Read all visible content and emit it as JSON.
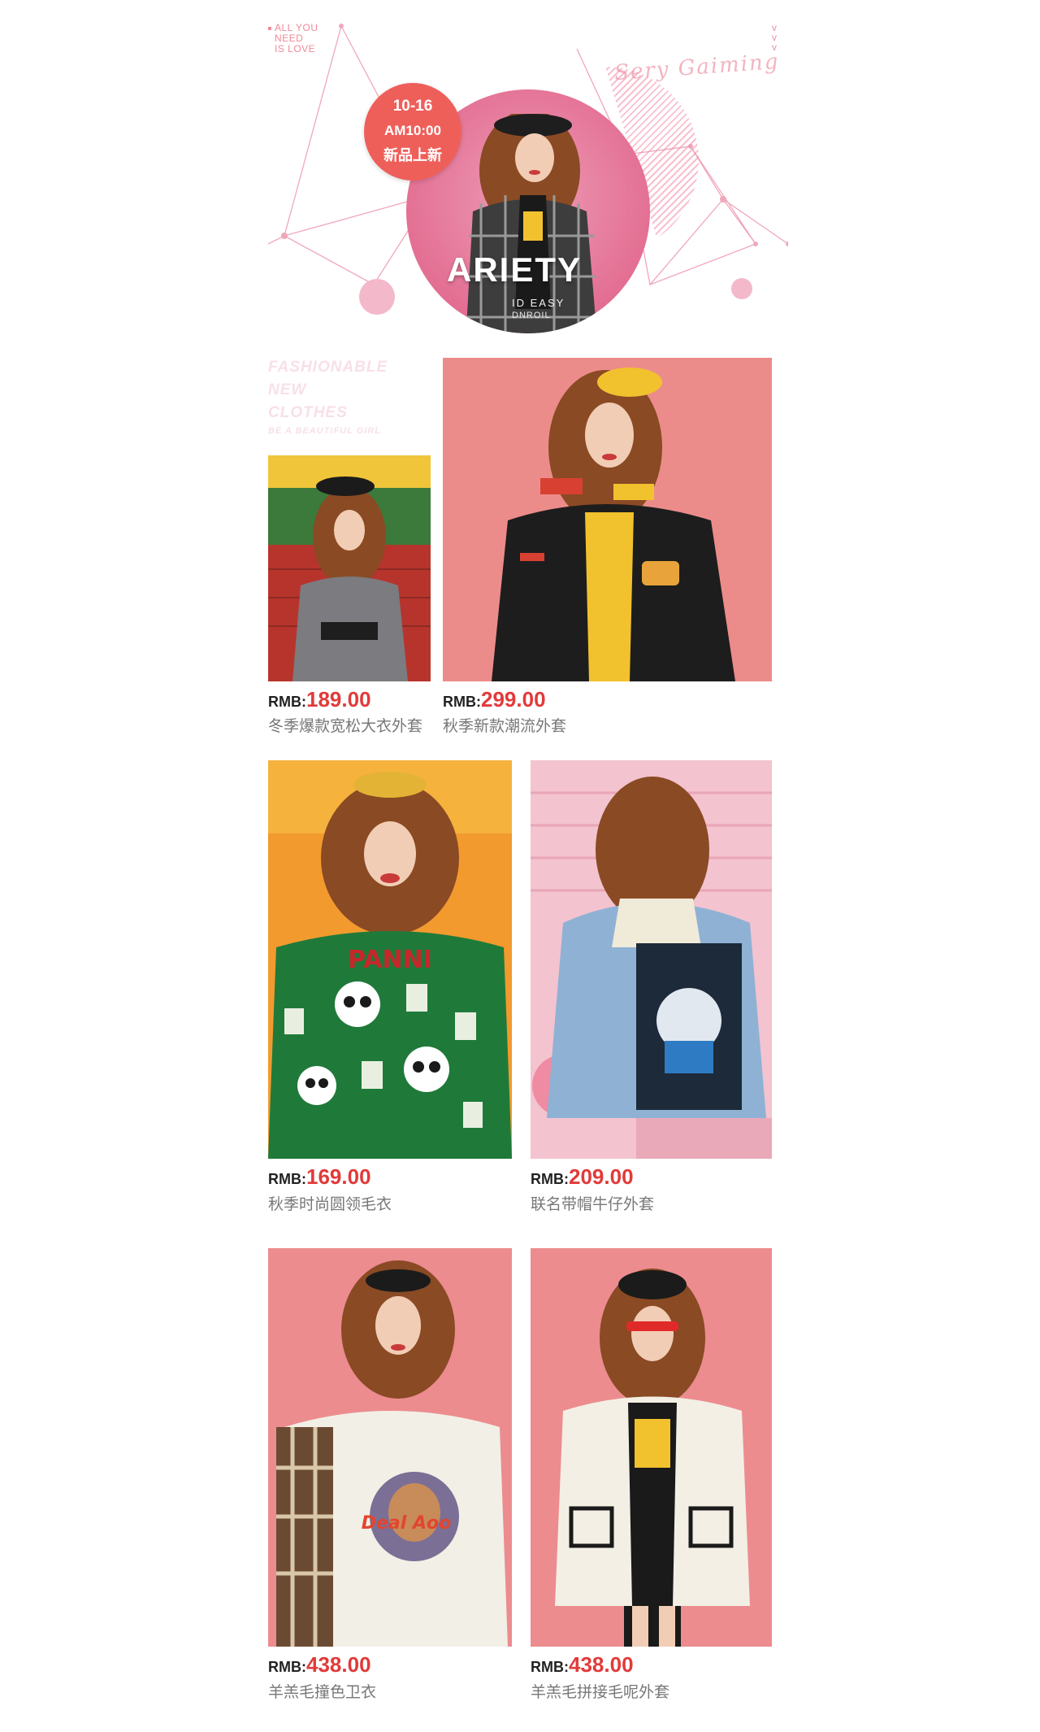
{
  "hero": {
    "tagline": [
      "ALL YOU",
      "NEED",
      "IS LOVE"
    ],
    "script_text": "Sery Gaiming",
    "v_marks": [
      "v",
      "v",
      "v"
    ],
    "badge": {
      "date": "10-16",
      "time": "AM10:00",
      "label": "新品上新"
    },
    "brand": "ARIETY",
    "brand_sub": "ID EASY",
    "brand_sub2": "DNROIL"
  },
  "section_title": {
    "lines": [
      "FASHIONABLE",
      "NEW",
      "CLOTHES"
    ],
    "subline": "BE A BEAUTIFUL GIRL"
  },
  "products": [
    {
      "currency": "RMB:",
      "price": "189.00",
      "name": "冬季爆款宽松大衣外套",
      "image": "gray-blazer-photo"
    },
    {
      "currency": "RMB:",
      "price": "299.00",
      "name": "秋季新款潮流外套",
      "image": "black-corduroy-jacket-photo"
    },
    {
      "currency": "RMB:",
      "price": "169.00",
      "name": "秋季时尚圆领毛衣",
      "image": "green-panda-sweater-photo",
      "print_text": "PANNI"
    },
    {
      "currency": "RMB:",
      "price": "209.00",
      "name": "联名带帽牛仔外套",
      "image": "denim-hooded-jacket-photo"
    },
    {
      "currency": "RMB:",
      "price": "438.00",
      "name": "羊羔毛撞色卫衣",
      "image": "plaid-sleeve-sweatshirt-photo",
      "print_text": "Deal Aoo"
    },
    {
      "currency": "RMB:",
      "price": "438.00",
      "name": "羊羔毛拼接毛呢外套",
      "image": "white-fleece-coat-photo"
    }
  ],
  "colors": {
    "price": "#e23a3a",
    "badge": "#ef5f5a",
    "accent_pink": "#e36f93"
  }
}
